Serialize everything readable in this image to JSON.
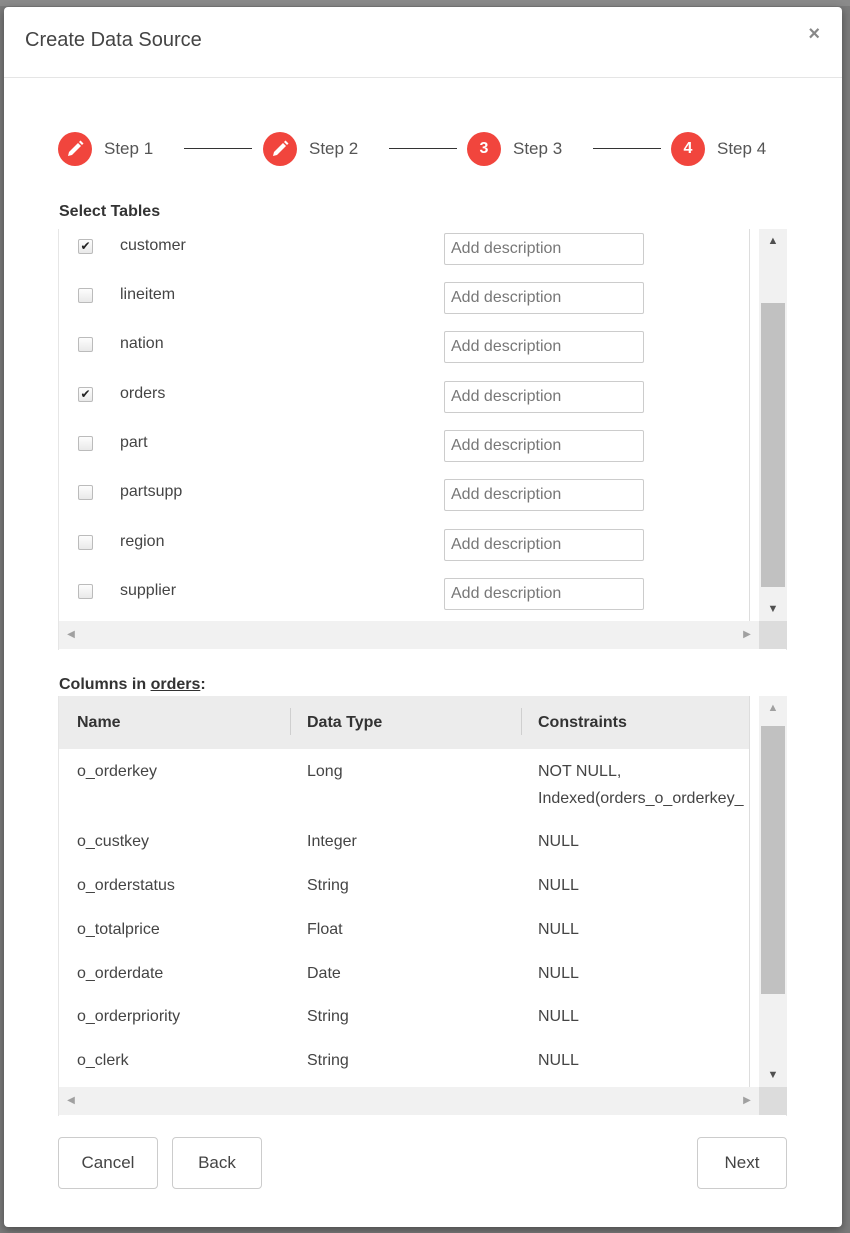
{
  "modal": {
    "title": "Create Data Source",
    "close": "×"
  },
  "stepper": {
    "steps": [
      {
        "label": "Step 1",
        "badge": "",
        "icon": "pencil-icon"
      },
      {
        "label": "Step 2",
        "badge": "",
        "icon": "pencil-icon"
      },
      {
        "label": "Step 3",
        "badge": "3",
        "icon": ""
      },
      {
        "label": "Step 4",
        "badge": "4",
        "icon": ""
      }
    ],
    "accent_color": "#f1453d"
  },
  "tables_section": {
    "heading": "Select Tables",
    "description_placeholder": "Add description",
    "rows": [
      {
        "name": "customer",
        "checked": true
      },
      {
        "name": "lineitem",
        "checked": false
      },
      {
        "name": "nation",
        "checked": false
      },
      {
        "name": "orders",
        "checked": true
      },
      {
        "name": "part",
        "checked": false
      },
      {
        "name": "partsupp",
        "checked": false
      },
      {
        "name": "region",
        "checked": false
      },
      {
        "name": "supplier",
        "checked": false
      }
    ]
  },
  "columns_section": {
    "heading_prefix": "Columns in ",
    "table_name": "orders",
    "heading_suffix": ":",
    "headers": [
      "Name",
      "Data Type",
      "Constraints"
    ],
    "rows": [
      {
        "name": "o_orderkey",
        "type": "Long",
        "constraints": [
          "NOT NULL,",
          "Indexed(orders_o_orderkey_"
        ]
      },
      {
        "name": "o_custkey",
        "type": "Integer",
        "constraints": [
          "NULL"
        ]
      },
      {
        "name": "o_orderstatus",
        "type": "String",
        "constraints": [
          "NULL"
        ]
      },
      {
        "name": "o_totalprice",
        "type": "Float",
        "constraints": [
          "NULL"
        ]
      },
      {
        "name": "o_orderdate",
        "type": "Date",
        "constraints": [
          "NULL"
        ]
      },
      {
        "name": "o_orderpriority",
        "type": "String",
        "constraints": [
          "NULL"
        ]
      },
      {
        "name": "o_clerk",
        "type": "String",
        "constraints": [
          "NULL"
        ]
      }
    ]
  },
  "footer": {
    "cancel": "Cancel",
    "back": "Back",
    "next": "Next"
  }
}
